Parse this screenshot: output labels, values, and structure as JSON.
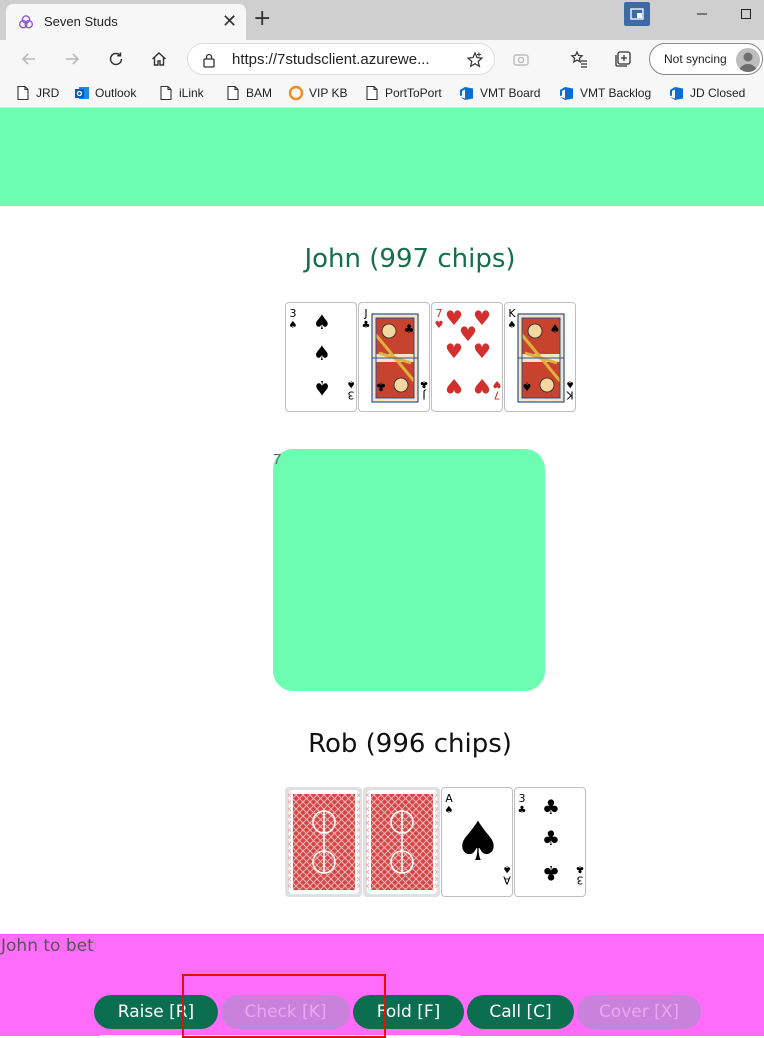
{
  "browser": {
    "tab_title": "Seven Studs",
    "tab_close": "✕",
    "new_tab": "+",
    "url": "https://7studsclient.azurewe...",
    "sync_label": "Not syncing",
    "favorites": [
      {
        "label": "JRD",
        "icon": "page-icon"
      },
      {
        "label": "Outlook",
        "icon": "outlook-icon"
      },
      {
        "label": "iLink",
        "icon": "page-icon"
      },
      {
        "label": "BAM",
        "icon": "page-icon"
      },
      {
        "label": "VIP KB",
        "icon": "ring-icon"
      },
      {
        "label": "PortToPort",
        "icon": "page-icon"
      },
      {
        "label": "VMT Board",
        "icon": "devops-icon"
      },
      {
        "label": "VMT Backlog",
        "icon": "devops-icon"
      },
      {
        "label": "JD Closed",
        "icon": "devops-icon"
      }
    ]
  },
  "game": {
    "player1": {
      "name": "John (997 chips)",
      "cards": [
        {
          "rank": "3",
          "suit": "♠",
          "color": "#000000",
          "type": "pip"
        },
        {
          "rank": "J",
          "suit": "♣",
          "color": "#000000",
          "type": "face"
        },
        {
          "rank": "7",
          "suit": "♥",
          "color": "#d32f2f",
          "type": "pip"
        },
        {
          "rank": "K",
          "suit": "♠",
          "color": "#000000",
          "type": "face"
        }
      ]
    },
    "pot_label": "7",
    "player2": {
      "name": "Rob (996 chips)",
      "cards": [
        {
          "type": "back"
        },
        {
          "type": "back"
        },
        {
          "rank": "A",
          "suit": "♠",
          "color": "#000000",
          "type": "ace"
        },
        {
          "rank": "3",
          "suit": "♣",
          "color": "#000000",
          "type": "pip"
        }
      ]
    },
    "status": "John to bet",
    "actions": [
      {
        "label": "Raise [R]",
        "enabled": true
      },
      {
        "label": "Check [K]",
        "enabled": false
      },
      {
        "label": "Fold [F]",
        "enabled": true
      },
      {
        "label": "Call [C]",
        "enabled": true
      },
      {
        "label": "Cover [X]",
        "enabled": false
      }
    ]
  },
  "colors": {
    "accent_green": "#6dfdb0",
    "status_pink": "#ff6cf9",
    "button_green": "#0b6e4e",
    "button_disabled": "#c982db",
    "highlight": "#e01010"
  }
}
